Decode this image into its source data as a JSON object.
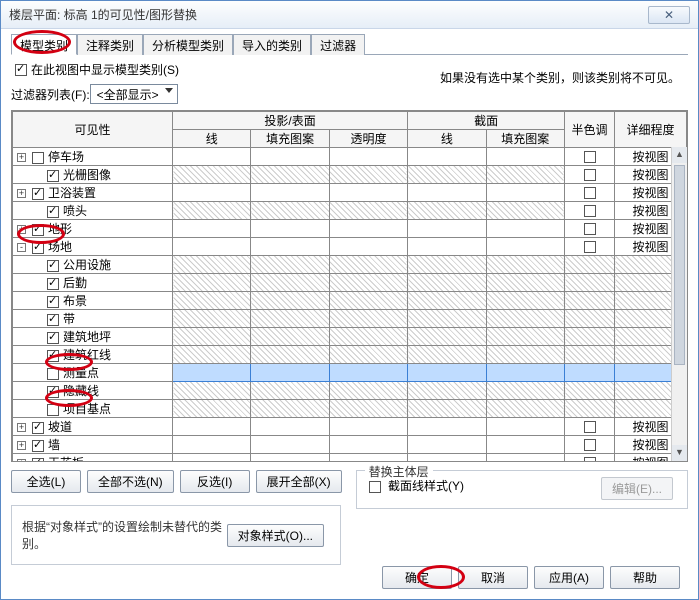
{
  "window": {
    "title": "楼层平面: 标高 1的可见性/图形替换",
    "close": "✕"
  },
  "tabs": [
    "模型类别",
    "注释类别",
    "分析模型类别",
    "导入的类别",
    "过滤器"
  ],
  "active_tab": 0,
  "opts": {
    "show_in_view_chk": true,
    "show_in_view_lbl": "在此视图中显示模型类别(S)",
    "filter_list_lbl": "过滤器列表(F):",
    "filter_value": "<全部显示>",
    "note_right": "如果没有选中某个类别，则该类别将不可见。"
  },
  "headers": {
    "visibility": "可见性",
    "proj": "投影/表面",
    "sect": "截面",
    "half": "半色调",
    "detail": "详细程度",
    "line": "线",
    "fill": "填充图案",
    "trans": "透明度"
  },
  "rows": [
    {
      "name": "停车场",
      "level": 0,
      "expander": "+",
      "checked": false,
      "hatch": false,
      "detail": "按视图",
      "half_cb": true
    },
    {
      "name": "光栅图像",
      "level": 1,
      "expander": "",
      "checked": true,
      "hatch": true,
      "detail": "按视图",
      "half_cb": true
    },
    {
      "name": "卫浴装置",
      "level": 0,
      "expander": "+",
      "checked": true,
      "hatch": false,
      "detail": "按视图",
      "half_cb": true
    },
    {
      "name": "喷头",
      "level": 1,
      "expander": "",
      "checked": true,
      "hatch": true,
      "detail": "按视图",
      "half_cb": true
    },
    {
      "name": "地形",
      "level": 0,
      "expander": "+",
      "checked": true,
      "hatch": false,
      "detail": "按视图",
      "half_cb": true
    },
    {
      "name": "场地",
      "level": 0,
      "expander": "-",
      "checked": true,
      "hatch": false,
      "detail": "按视图",
      "half_cb": true,
      "addclass": "site-row"
    },
    {
      "name": "公用设施",
      "level": 1,
      "expander": "",
      "checked": true,
      "hatch": true,
      "detail": "",
      "half_cb": false
    },
    {
      "name": "后勤",
      "level": 1,
      "expander": "",
      "checked": true,
      "hatch": true,
      "detail": "",
      "half_cb": false
    },
    {
      "name": "布景",
      "level": 1,
      "expander": "",
      "checked": true,
      "hatch": true,
      "detail": "",
      "half_cb": false
    },
    {
      "name": "带",
      "level": 1,
      "expander": "",
      "checked": true,
      "hatch": true,
      "detail": "",
      "half_cb": false
    },
    {
      "name": "建筑地坪",
      "level": 1,
      "expander": "",
      "checked": true,
      "hatch": true,
      "detail": "",
      "half_cb": false
    },
    {
      "name": "建筑红线",
      "level": 1,
      "expander": "",
      "checked": true,
      "hatch": true,
      "detail": "",
      "half_cb": false
    },
    {
      "name": "测量点",
      "level": 1,
      "expander": "",
      "checked": false,
      "hatch": true,
      "detail": "",
      "half_cb": false,
      "selected": true
    },
    {
      "name": "隐藏线",
      "level": 1,
      "expander": "",
      "checked": true,
      "hatch": true,
      "detail": "",
      "half_cb": false
    },
    {
      "name": "项目基点",
      "level": 1,
      "expander": "",
      "checked": false,
      "hatch": true,
      "detail": "",
      "half_cb": false
    },
    {
      "name": "坡道",
      "level": 0,
      "expander": "+",
      "checked": true,
      "hatch": false,
      "detail": "按视图",
      "half_cb": true
    },
    {
      "name": "墙",
      "level": 0,
      "expander": "+",
      "checked": true,
      "hatch": false,
      "detail": "按视图",
      "half_cb": true
    },
    {
      "name": "天花板",
      "level": 0,
      "expander": "+",
      "checked": true,
      "hatch": false,
      "detail": "按视图",
      "half_cb": true
    }
  ],
  "actions": {
    "all": "全选(L)",
    "none": "全部不选(N)",
    "invert": "反选(I)",
    "expand": "展开全部(X)",
    "host_legend": "替换主体层",
    "cut_style": "截面线样式(Y)",
    "edit": "编辑(E)...",
    "info": "根据“对象样式”的设置绘制未替代的类别。",
    "obj_style": "对象样式(O)..."
  },
  "footer": {
    "ok": "确定",
    "cancel": "取消",
    "apply": "应用(A)",
    "help": "帮助"
  }
}
